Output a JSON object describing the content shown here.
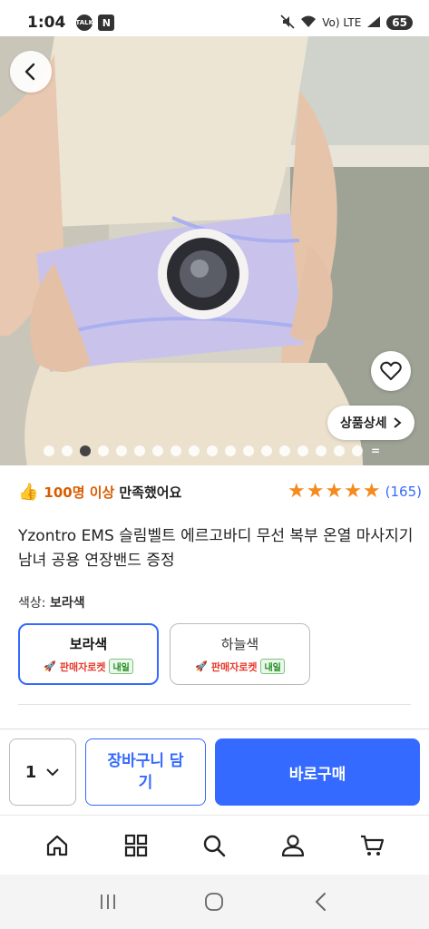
{
  "status_bar": {
    "time": "1:04",
    "talk_badge": "TALK",
    "n_badge": "N",
    "network": "Vo) LTE",
    "battery": "65"
  },
  "gallery": {
    "detail_button": "상품상세",
    "image_count": 18,
    "active_index": 2
  },
  "satisfaction": {
    "count": "100명 이상",
    "text": "만족했어요",
    "rating": 5,
    "review_count": "(165)"
  },
  "product": {
    "title": "Yzontro EMS 슬림벨트 에르고바디 무선 복부 온열 마사지기 남녀 공용 연장밴드 증정",
    "option_label": "색상:",
    "selected_option": "보라색"
  },
  "options": [
    {
      "name": "보라색",
      "rocket": "판매자로켓",
      "delivery": "내일",
      "selected": true
    },
    {
      "name": "하늘색",
      "rocket": "판매자로켓",
      "delivery": "내일",
      "selected": false
    }
  ],
  "purchase": {
    "quantity": "1",
    "cart_label": "장바구니 담기",
    "buy_label": "바로구매"
  },
  "colors": {
    "accent": "#346aff",
    "star": "#f58a1f",
    "rocket": "#e8392a",
    "belt": "#c9c3ec"
  },
  "nav_icons": [
    "home-icon",
    "category-icon",
    "search-icon",
    "profile-icon",
    "cart-icon"
  ]
}
